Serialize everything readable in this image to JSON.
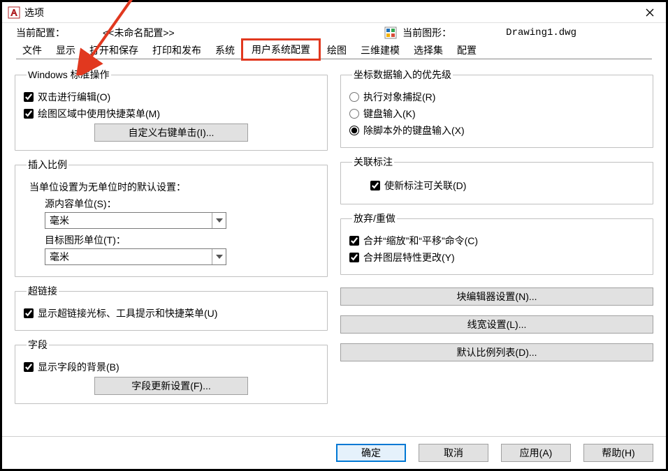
{
  "window": {
    "title": "选项"
  },
  "profile": {
    "label": "当前配置：",
    "value": "<<未命名配置>>",
    "drawingLabel": "当前图形：",
    "drawingFile": "Drawing1.dwg"
  },
  "tabs": {
    "t0": "文件",
    "t1": "显示",
    "t2": "打开和保存",
    "t3": "打印和发布",
    "t4": "系统",
    "t5": "用户系统配置",
    "t6": "绘图",
    "t7": "三维建模",
    "t8": "选择集",
    "t9": "配置"
  },
  "left": {
    "winstd": {
      "legend": "Windows 标准操作",
      "opt1": "双击进行编辑(O)",
      "opt2": "绘图区域中使用快捷菜单(M)",
      "btn": "自定义右键单击(I)..."
    },
    "insert": {
      "legend": "插入比例",
      "desc": "当单位设置为无单位时的默认设置：",
      "srcLabel": "源内容单位(S)：",
      "srcValue": "毫米",
      "tgtLabel": "目标图形单位(T)：",
      "tgtValue": "毫米"
    },
    "hyperlink": {
      "legend": "超链接",
      "opt1": "显示超链接光标、工具提示和快捷菜单(U)"
    },
    "fields": {
      "legend": "字段",
      "opt1": "显示字段的背景(B)",
      "btn": "字段更新设置(F)..."
    }
  },
  "right": {
    "priority": {
      "legend": "坐标数据输入的优先级",
      "r1": "执行对象捕捉(R)",
      "r2": "键盘输入(K)",
      "r3": "除脚本外的键盘输入(X)"
    },
    "assoc": {
      "legend": "关联标注",
      "opt1": "使新标注可关联(D)"
    },
    "undo": {
      "legend": "放弃/重做",
      "opt1": "合并“缩放”和“平移”命令(C)",
      "opt2": "合并图层特性更改(Y)"
    },
    "btnBlock": "块编辑器设置(N)...",
    "btnLw": "线宽设置(L)...",
    "btnScale": "默认比例列表(D)..."
  },
  "footer": {
    "ok": "确定",
    "cancel": "取消",
    "apply": "应用(A)",
    "help": "帮助(H)"
  }
}
